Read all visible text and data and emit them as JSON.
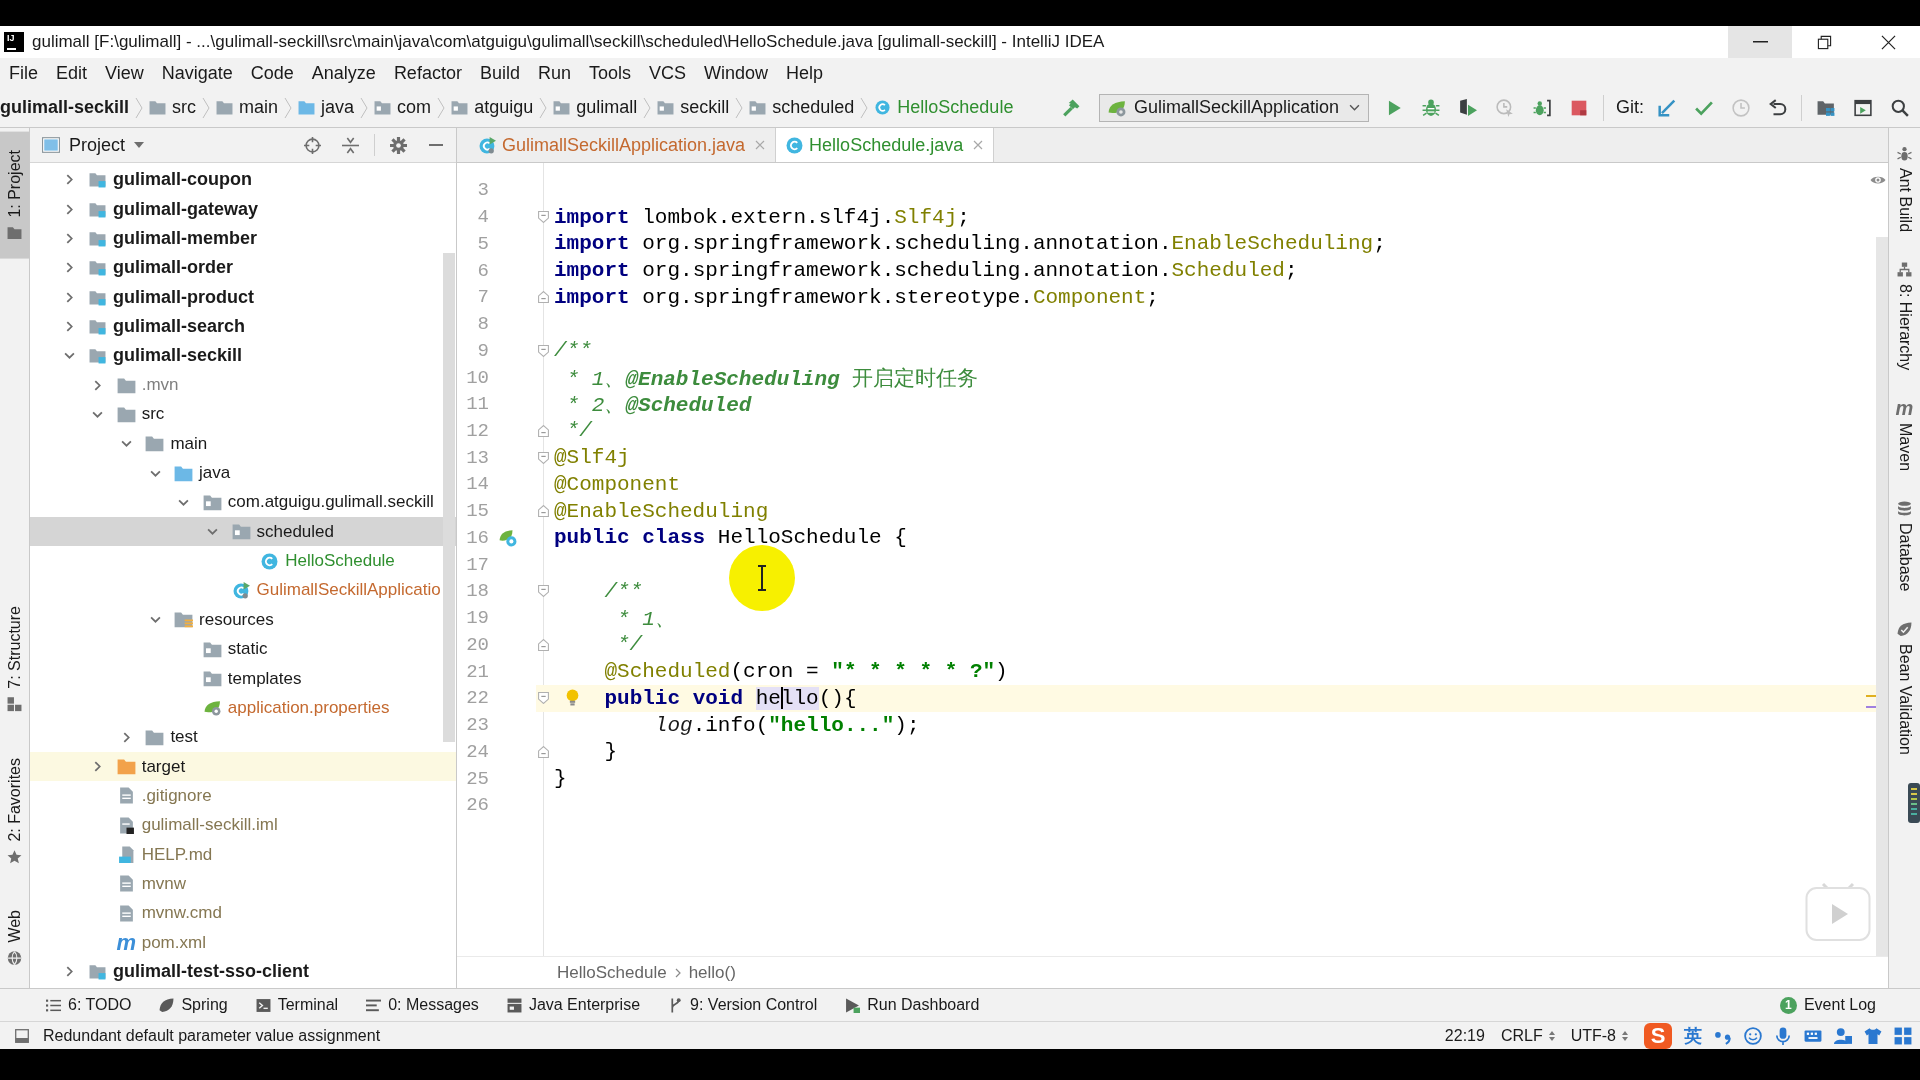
{
  "window": {
    "icon_label": "IJ",
    "title": "gulimall [F:\\gulimall] - ...\\gulimall-seckill\\src\\main\\java\\com\\atguigu\\gulimall\\seckill\\scheduled\\HelloSchedule.java [gulimall-seckill] - IntelliJ IDEA",
    "controls": [
      {
        "kind": "minimize",
        "hovered": true
      },
      {
        "kind": "restore",
        "hovered": false
      },
      {
        "kind": "close",
        "hovered": false
      }
    ]
  },
  "menu": [
    "File",
    "Edit",
    "View",
    "Navigate",
    "Code",
    "Analyze",
    "Refactor",
    "Build",
    "Run",
    "Tools",
    "VCS",
    "Window",
    "Help"
  ],
  "navigation_bar": {
    "breadcrumbs": [
      {
        "label": "gulimall-seckill",
        "kind": "module"
      },
      {
        "label": "src",
        "kind": "folder"
      },
      {
        "label": "main",
        "kind": "folder"
      },
      {
        "label": "java",
        "kind": "source-folder"
      },
      {
        "label": "com",
        "kind": "package"
      },
      {
        "label": "atguigu",
        "kind": "package"
      },
      {
        "label": "gulimall",
        "kind": "package"
      },
      {
        "label": "seckill",
        "kind": "package"
      },
      {
        "label": "scheduled",
        "kind": "package"
      },
      {
        "label": "HelloSchedule",
        "kind": "class",
        "color": "#2f8f2f"
      }
    ]
  },
  "toolbar": {
    "run_configuration": "GulimallSeckillApplication",
    "run_buttons": [
      {
        "kind": "run",
        "disabled": false
      },
      {
        "kind": "debug",
        "disabled": false
      },
      {
        "kind": "coverage",
        "disabled": false
      },
      {
        "kind": "profile",
        "disabled": true
      },
      {
        "kind": "attach",
        "disabled": false
      },
      {
        "kind": "stop",
        "disabled": false
      }
    ],
    "vcs_label": "Git:",
    "vcs_buttons": [
      {
        "kind": "update",
        "disabled": false
      },
      {
        "kind": "commit",
        "disabled": false
      },
      {
        "kind": "history",
        "disabled": true
      },
      {
        "kind": "rollback",
        "disabled": false
      }
    ],
    "window_buttons": [
      {
        "kind": "project-structure",
        "disabled": false
      },
      {
        "kind": "run-window",
        "disabled": false
      },
      {
        "kind": "search",
        "disabled": false
      }
    ]
  },
  "left_tool_strip": {
    "top": [
      {
        "label": "1: Project",
        "kind": "project",
        "selected": true
      }
    ],
    "bottom": [
      {
        "label": "7: Structure",
        "kind": "structure",
        "selected": false
      },
      {
        "label": "2: Favorites",
        "kind": "favorites",
        "selected": false
      },
      {
        "label": "Web",
        "kind": "web",
        "selected": false
      }
    ]
  },
  "project_panel": {
    "title": "Project",
    "tree": [
      {
        "label": "gulimall-coupon",
        "kind": "module",
        "expanded": false,
        "selected": false,
        "highlighted": false
      },
      {
        "label": "gulimall-gateway",
        "kind": "module",
        "expanded": false,
        "selected": false,
        "highlighted": false
      },
      {
        "label": "gulimall-member",
        "kind": "module",
        "expanded": false,
        "selected": false,
        "highlighted": false
      },
      {
        "label": "gulimall-order",
        "kind": "module",
        "expanded": false,
        "selected": false,
        "highlighted": false
      },
      {
        "label": "gulimall-product",
        "kind": "module",
        "expanded": false,
        "selected": false,
        "highlighted": false
      },
      {
        "label": "gulimall-search",
        "kind": "module",
        "expanded": false,
        "selected": false,
        "highlighted": false
      },
      {
        "label": "gulimall-seckill",
        "kind": "module",
        "expanded": true,
        "selected": false,
        "highlighted": false,
        "children": [
          {
            "label": ".mvn",
            "kind": "folder",
            "color": "#7f7f7f",
            "expanded": false,
            "selected": false,
            "highlighted": false
          },
          {
            "label": "src",
            "kind": "folder",
            "expanded": true,
            "selected": false,
            "highlighted": false,
            "children": [
              {
                "label": "main",
                "kind": "folder",
                "expanded": true,
                "selected": false,
                "highlighted": false,
                "children": [
                  {
                    "label": "java",
                    "kind": "source-folder",
                    "expanded": true,
                    "selected": false,
                    "highlighted": false,
                    "children": [
                      {
                        "label": "com.atguigu.gulimall.seckill",
                        "kind": "package",
                        "expanded": true,
                        "selected": false,
                        "highlighted": false,
                        "children": [
                          {
                            "label": "scheduled",
                            "kind": "package",
                            "expanded": true,
                            "selected": true,
                            "highlighted": false,
                            "children": [
                              {
                                "label": "HelloSchedule",
                                "kind": "class",
                                "color": "#2f8f2f",
                                "selected": false,
                                "highlighted": false
                              }
                            ]
                          },
                          {
                            "label": "GulimallSeckillApplicatio",
                            "kind": "app-class",
                            "color": "#c4692f",
                            "selected": false,
                            "highlighted": false
                          }
                        ]
                      }
                    ]
                  },
                  {
                    "label": "resources",
                    "kind": "resource-folder",
                    "expanded": true,
                    "selected": false,
                    "highlighted": false,
                    "children": [
                      {
                        "label": "static",
                        "kind": "package",
                        "selected": false,
                        "highlighted": false
                      },
                      {
                        "label": "templates",
                        "kind": "package",
                        "selected": false,
                        "highlighted": false
                      },
                      {
                        "label": "application.properties",
                        "kind": "properties",
                        "color": "#c4692f",
                        "selected": false,
                        "highlighted": false
                      }
                    ]
                  }
                ]
              },
              {
                "label": "test",
                "kind": "folder",
                "expanded": false,
                "selected": false,
                "highlighted": false
              }
            ]
          },
          {
            "label": "target",
            "kind": "excluded-folder",
            "expanded": false,
            "selected": false,
            "highlighted": true
          },
          {
            "label": ".gitignore",
            "kind": "file",
            "color": "#857752",
            "selected": false,
            "highlighted": false
          },
          {
            "label": "gulimall-seckill.iml",
            "kind": "iml",
            "color": "#857752",
            "selected": false,
            "highlighted": false
          },
          {
            "label": "HELP.md",
            "kind": "markdown",
            "color": "#857752",
            "selected": false,
            "highlighted": false
          },
          {
            "label": "mvnw",
            "kind": "file",
            "color": "#857752",
            "selected": false,
            "highlighted": false
          },
          {
            "label": "mvnw.cmd",
            "kind": "file",
            "color": "#857752",
            "selected": false,
            "highlighted": false
          },
          {
            "label": "pom.xml",
            "kind": "maven",
            "glyph": "m",
            "color": "#857752",
            "selected": false,
            "highlighted": false
          }
        ]
      },
      {
        "label": "gulimall-test-sso-client",
        "kind": "module",
        "expanded": false,
        "selected": false,
        "highlighted": false
      }
    ]
  },
  "tabs": [
    {
      "label": "GulimallSeckillApplication.java",
      "kind": "app-class",
      "color": "#c4692f",
      "selected": false
    },
    {
      "label": "HelloSchedule.java",
      "kind": "class",
      "color": "#2f8f2f",
      "selected": true
    }
  ],
  "editor": {
    "lines": [
      {
        "number": "3",
        "current": false
      },
      {
        "number": "4",
        "current": false,
        "fold_marker": {
          "kind": "start"
        },
        "tokens": [
          {
            "text": "import ",
            "kind": "keyword"
          },
          {
            "text": "lombok.extern.slf4j.",
            "kind": "plain"
          },
          {
            "text": "Slf4j",
            "kind": "annotation"
          },
          {
            "text": ";",
            "kind": "plain"
          }
        ]
      },
      {
        "number": "5",
        "current": false,
        "tokens": [
          {
            "text": "import ",
            "kind": "keyword"
          },
          {
            "text": "org.springframework.scheduling.annotation.",
            "kind": "plain"
          },
          {
            "text": "EnableScheduling",
            "kind": "annotation"
          },
          {
            "text": ";",
            "kind": "plain"
          }
        ]
      },
      {
        "number": "6",
        "current": false,
        "tokens": [
          {
            "text": "import ",
            "kind": "keyword"
          },
          {
            "text": "org.springframework.scheduling.annotation.",
            "kind": "plain"
          },
          {
            "text": "Scheduled",
            "kind": "annotation"
          },
          {
            "text": ";",
            "kind": "plain"
          }
        ]
      },
      {
        "number": "7",
        "current": false,
        "fold_marker": {
          "kind": "end"
        },
        "tokens": [
          {
            "text": "import ",
            "kind": "keyword"
          },
          {
            "text": "org.springframework.stereotype.",
            "kind": "plain"
          },
          {
            "text": "Component",
            "kind": "annotation"
          },
          {
            "text": ";",
            "kind": "plain"
          }
        ]
      },
      {
        "number": "8",
        "current": false
      },
      {
        "number": "9",
        "current": false,
        "fold_marker": {
          "kind": "start"
        },
        "tokens": [
          {
            "text": "/**",
            "kind": "doc"
          }
        ]
      },
      {
        "number": "10",
        "current": false,
        "tokens": [
          {
            "text": " * 1、",
            "kind": "doc"
          },
          {
            "text": "@EnableScheduling",
            "kind": "doc-tag"
          },
          {
            "text": " 开启定时任务",
            "kind": "doc-text"
          }
        ]
      },
      {
        "number": "11",
        "current": false,
        "tokens": [
          {
            "text": " * 2、",
            "kind": "doc"
          },
          {
            "text": "@Scheduled",
            "kind": "doc-tag"
          }
        ]
      },
      {
        "number": "12",
        "current": false,
        "fold_marker": {
          "kind": "end"
        },
        "tokens": [
          {
            "text": " */",
            "kind": "doc"
          }
        ]
      },
      {
        "number": "13",
        "current": false,
        "fold_marker": {
          "kind": "start"
        },
        "tokens": [
          {
            "text": "@Slf4j",
            "kind": "annotation"
          }
        ]
      },
      {
        "number": "14",
        "current": false,
        "tokens": [
          {
            "text": "@Component",
            "kind": "annotation"
          }
        ]
      },
      {
        "number": "15",
        "current": false,
        "fold_marker": {
          "kind": "end"
        },
        "tokens": [
          {
            "text": "@EnableScheduling",
            "kind": "annotation"
          }
        ]
      },
      {
        "number": "16",
        "current": false,
        "gutter_marks": [
          {
            "kind": "bean"
          }
        ],
        "tokens": [
          {
            "text": "public class ",
            "kind": "keyword"
          },
          {
            "text": "HelloSchedule {",
            "kind": "plain"
          }
        ]
      },
      {
        "number": "17",
        "current": false
      },
      {
        "number": "18",
        "current": false,
        "fold_marker": {
          "kind": "start"
        },
        "tokens": [
          {
            "text": "    /**",
            "kind": "doc"
          }
        ]
      },
      {
        "number": "19",
        "current": false,
        "tokens": [
          {
            "text": "     * 1、",
            "kind": "doc"
          }
        ]
      },
      {
        "number": "20",
        "current": false,
        "fold_marker": {
          "kind": "end"
        },
        "tokens": [
          {
            "text": "     */",
            "kind": "doc"
          }
        ]
      },
      {
        "number": "21",
        "current": false,
        "tokens": [
          {
            "text": "    @Scheduled",
            "kind": "annotation"
          },
          {
            "text": "(cron = ",
            "kind": "plain"
          },
          {
            "text": "\"* * * * * ?\"",
            "kind": "string"
          },
          {
            "text": ")",
            "kind": "plain"
          }
        ]
      },
      {
        "number": "22",
        "current": true,
        "fold_marker": {
          "kind": "start"
        },
        "gutter_marks": [
          {
            "kind": "bulb"
          }
        ],
        "tokens": [
          {
            "text": "    public void ",
            "kind": "keyword"
          },
          {
            "text": "he",
            "kind": "usage"
          },
          {
            "kind": "caret"
          },
          {
            "text": "llo",
            "kind": "usage"
          },
          {
            "text": "(){",
            "kind": "plain"
          }
        ]
      },
      {
        "number": "23",
        "current": false,
        "tokens": [
          {
            "text": "        log",
            "kind": "static"
          },
          {
            "text": ".info(",
            "kind": "plain"
          },
          {
            "text": "\"hello...\"",
            "kind": "string"
          },
          {
            "text": ");",
            "kind": "plain"
          }
        ]
      },
      {
        "number": "24",
        "current": false,
        "fold_marker": {
          "kind": "end"
        },
        "tokens": [
          {
            "text": "    }",
            "kind": "plain"
          }
        ]
      },
      {
        "number": "25",
        "current": false,
        "tokens": [
          {
            "text": "}",
            "kind": "plain"
          }
        ]
      },
      {
        "number": "26",
        "current": false
      }
    ],
    "breadcrumbs": [
      "HelloSchedule",
      "hello()"
    ]
  },
  "right_tool_strip": [
    {
      "label": "Ant Build",
      "kind": "ant",
      "selected": false
    },
    {
      "label": "8: Hierarchy",
      "kind": "hierarchy",
      "selected": false
    },
    {
      "label": "Maven",
      "kind": "maven",
      "glyph": "m",
      "selected": false
    },
    {
      "label": "Database",
      "kind": "database",
      "selected": false
    },
    {
      "label": "Bean Validation",
      "kind": "bean-validation",
      "selected": false
    }
  ],
  "tool_window_bar": {
    "items": [
      {
        "label": "6: TODO",
        "kind": "todo",
        "selected": false
      },
      {
        "label": "Spring",
        "kind": "spring",
        "selected": false
      },
      {
        "label": "Terminal",
        "kind": "terminal",
        "selected": false
      },
      {
        "label": "0: Messages",
        "kind": "messages",
        "selected": false
      },
      {
        "label": "Java Enterprise",
        "kind": "java-enterprise",
        "selected": false
      },
      {
        "label": "9: Version Control",
        "kind": "version-control",
        "selected": false
      },
      {
        "label": "Run Dashboard",
        "kind": "run-dashboard",
        "selected": false
      }
    ],
    "event_log": {
      "label": "Event Log",
      "badge": "1",
      "selected": false
    }
  },
  "status_bar": {
    "message": "Redundant default parameter value assignment",
    "position": "22:19",
    "line_separator": "CRLF",
    "encoding": "UTF-8",
    "ime": {
      "logo": "S",
      "language": "英"
    }
  }
}
